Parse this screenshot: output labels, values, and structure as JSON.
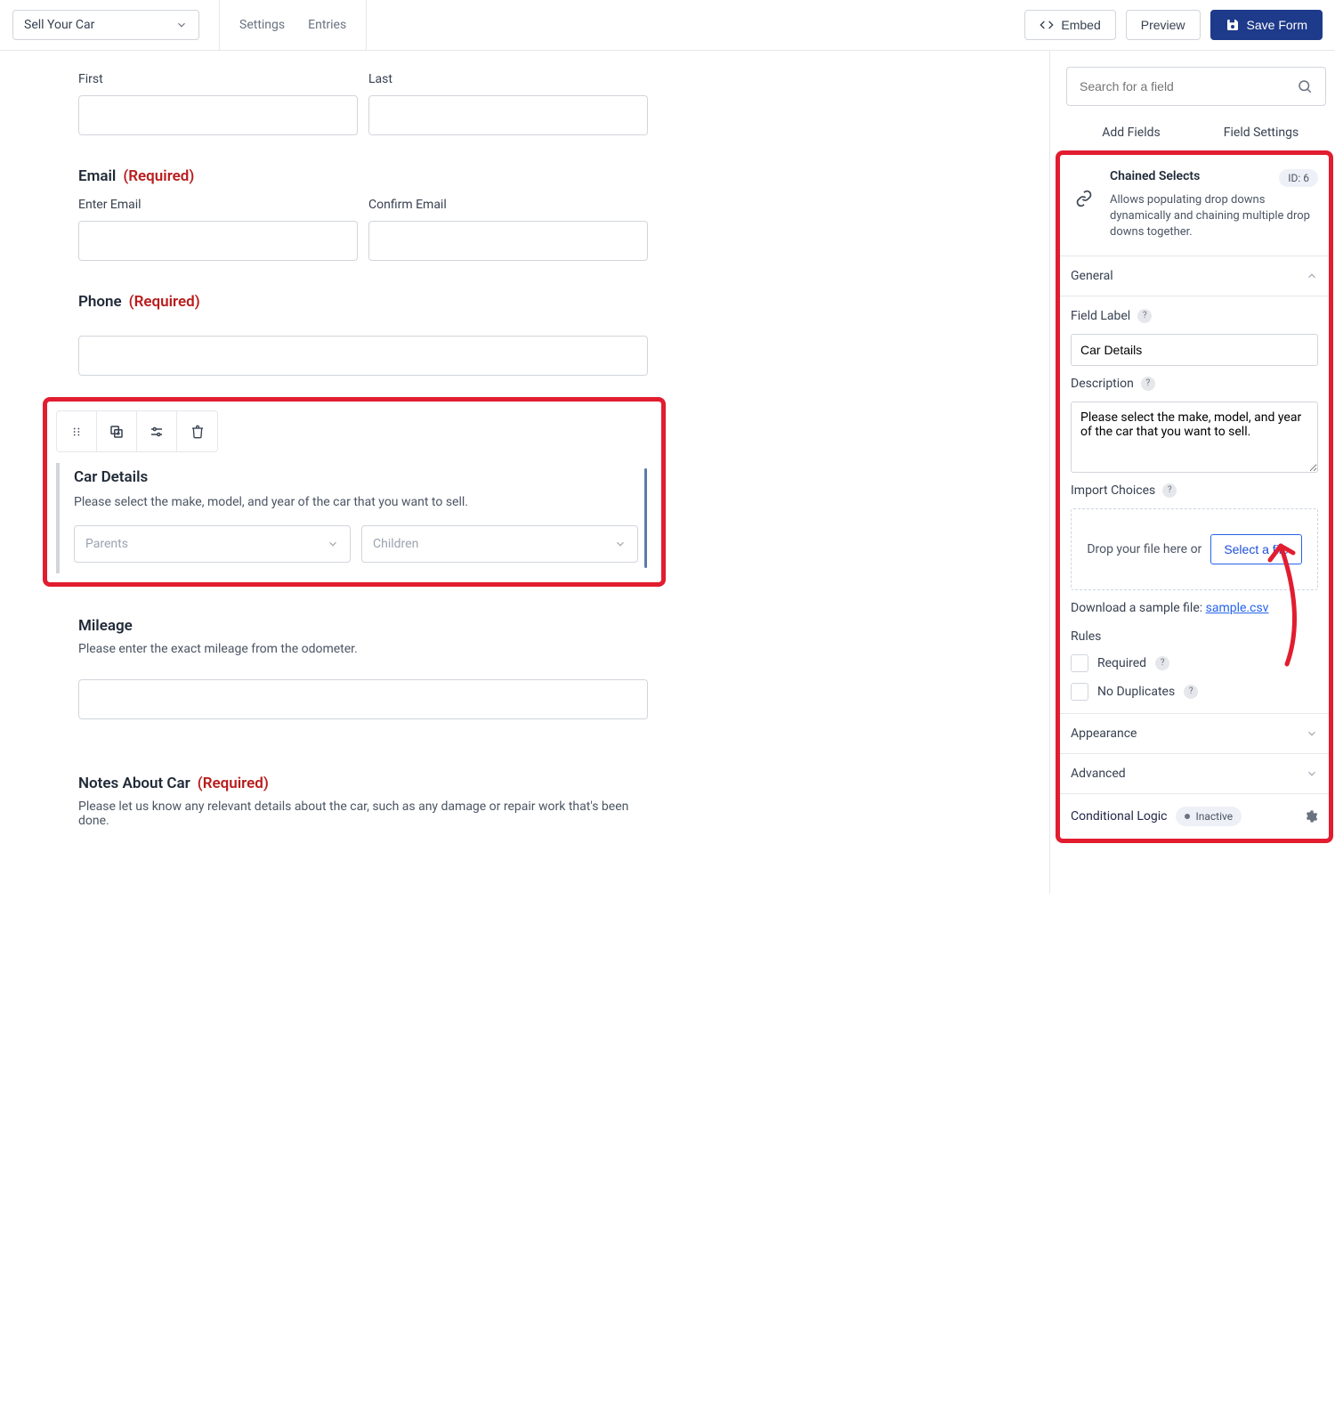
{
  "topbar": {
    "form_name": "Sell Your Car",
    "nav": {
      "settings": "Settings",
      "entries": "Entries"
    },
    "embed": "Embed",
    "preview": "Preview",
    "save": "Save Form"
  },
  "form": {
    "first_label": "First",
    "last_label": "Last",
    "email_section": "Email",
    "required": "(Required)",
    "enter_email": "Enter Email",
    "confirm_email": "Confirm Email",
    "phone_section": "Phone",
    "car_details_title": "Car Details",
    "car_details_desc": "Please select the make, model, and year of the car that you want to sell.",
    "parents_ph": "Parents",
    "children_ph": "Children",
    "mileage_title": "Mileage",
    "mileage_desc": "Please enter the exact mileage from the odometer.",
    "notes_title": "Notes About Car",
    "notes_desc": "Please let us know any relevant details about the car, such as any damage or repair work that's been done."
  },
  "sidebar": {
    "search_placeholder": "Search for a field",
    "tabs": {
      "add": "Add Fields",
      "settings": "Field Settings"
    },
    "field_type": "Chained Selects",
    "id_badge": "ID: 6",
    "field_type_desc": "Allows populating drop downs dynamically and chaining multiple drop downs together.",
    "general": "General",
    "field_label_lbl": "Field Label",
    "field_label_val": "Car Details",
    "description_lbl": "Description",
    "description_val": "Please select the make, model, and year of the car that you want to sell.",
    "import_choices_lbl": "Import Choices",
    "drop_text": "Drop your file here or",
    "select_file": "Select a file",
    "sample_prefix": "Download a sample file: ",
    "sample_link": "sample.csv",
    "rules": "Rules",
    "required_lbl": "Required",
    "nodup_lbl": "No Duplicates",
    "appearance": "Appearance",
    "advanced": "Advanced",
    "cond_logic": "Conditional Logic",
    "inactive": "Inactive"
  }
}
